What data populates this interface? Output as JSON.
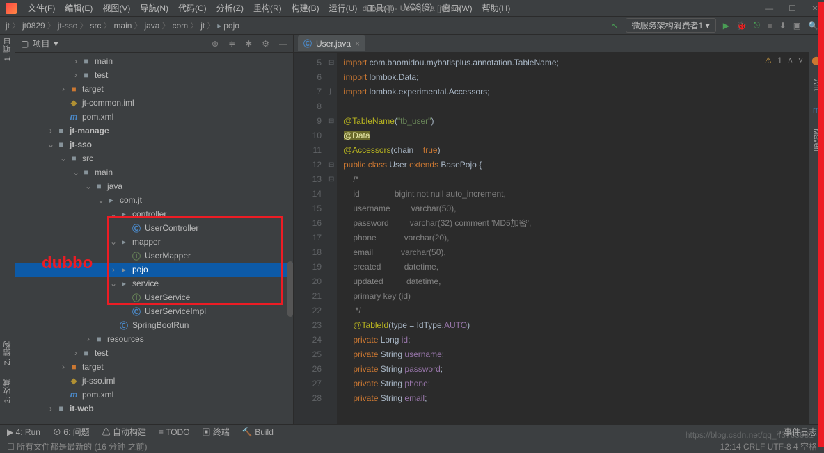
{
  "menubar": {
    "items": [
      "文件(F)",
      "编辑(E)",
      "视图(V)",
      "导航(N)",
      "代码(C)",
      "分析(Z)",
      "重构(R)",
      "构建(B)",
      "运行(U)",
      "工具(T)",
      "VCS(S)",
      "窗口(W)",
      "帮助(H)"
    ],
    "title": "dubbo-jt - User.java [jt-sso]"
  },
  "breadcrumbs": [
    "jt",
    "jt0829",
    "jt-sso",
    "src",
    "main",
    "java",
    "com",
    "jt",
    "pojo"
  ],
  "run_config": "微服务架构消费者1",
  "project_panel": {
    "title": "项目"
  },
  "left_tabs": [
    "1: 项目"
  ],
  "left_tabs_bottom": [
    "Z: 结构",
    "2: 收藏"
  ],
  "right_tabs": [
    "Ant",
    "Maven"
  ],
  "tree": [
    {
      "depth": 4,
      "arrow": ">",
      "icon": "folder",
      "label": "main"
    },
    {
      "depth": 4,
      "arrow": ">",
      "icon": "folder",
      "label": "test"
    },
    {
      "depth": 3,
      "arrow": ">",
      "icon": "folder-orange",
      "label": "target"
    },
    {
      "depth": 3,
      "arrow": "",
      "icon": "iml",
      "label": "jt-common.iml"
    },
    {
      "depth": 3,
      "arrow": "",
      "icon": "mvn",
      "label": "pom.xml"
    },
    {
      "depth": 2,
      "arrow": ">",
      "icon": "folder",
      "label": "jt-manage",
      "bold": true
    },
    {
      "depth": 2,
      "arrow": "v",
      "icon": "folder",
      "label": "jt-sso",
      "bold": true
    },
    {
      "depth": 3,
      "arrow": "v",
      "icon": "folder",
      "label": "src"
    },
    {
      "depth": 4,
      "arrow": "v",
      "icon": "folder",
      "label": "main"
    },
    {
      "depth": 5,
      "arrow": "v",
      "icon": "folder",
      "label": "java"
    },
    {
      "depth": 6,
      "arrow": "v",
      "icon": "pkg",
      "label": "com.jt"
    },
    {
      "depth": 7,
      "arrow": "v",
      "icon": "pkg",
      "label": "controller"
    },
    {
      "depth": 8,
      "arrow": "",
      "icon": "class",
      "label": "UserController"
    },
    {
      "depth": 7,
      "arrow": "v",
      "icon": "pkg",
      "label": "mapper"
    },
    {
      "depth": 8,
      "arrow": "",
      "icon": "iface",
      "label": "UserMapper"
    },
    {
      "depth": 7,
      "arrow": ">",
      "icon": "pkg",
      "label": "pojo",
      "selected": true
    },
    {
      "depth": 7,
      "arrow": "v",
      "icon": "pkg",
      "label": "service"
    },
    {
      "depth": 8,
      "arrow": "",
      "icon": "iface",
      "label": "UserService"
    },
    {
      "depth": 8,
      "arrow": "",
      "icon": "class",
      "label": "UserServiceImpl"
    },
    {
      "depth": 7,
      "arrow": "",
      "icon": "class",
      "label": "SpringBootRun"
    },
    {
      "depth": 5,
      "arrow": ">",
      "icon": "folder",
      "label": "resources"
    },
    {
      "depth": 4,
      "arrow": ">",
      "icon": "folder",
      "label": "test"
    },
    {
      "depth": 3,
      "arrow": ">",
      "icon": "folder-orange",
      "label": "target"
    },
    {
      "depth": 3,
      "arrow": "",
      "icon": "iml",
      "label": "jt-sso.iml"
    },
    {
      "depth": 3,
      "arrow": "",
      "icon": "mvn",
      "label": "pom.xml"
    },
    {
      "depth": 2,
      "arrow": ">",
      "icon": "folder",
      "label": "it-web",
      "bold": true
    }
  ],
  "annotation": "dubbo",
  "editor_tab": "User.java",
  "warnings": "1",
  "code": {
    "start": 5,
    "lines": [
      {
        "n": 5,
        "html": "<span class='kw'>import</span> com.baomidou.mybatisplus.annotation.<span class='cls'>TableName</span>;"
      },
      {
        "n": 6,
        "html": "<span class='kw'>import</span> lombok.<span class='cls'>Data</span>;"
      },
      {
        "n": 7,
        "html": "<span class='kw'>import</span> lombok.experimental.<span class='cls'>Accessors</span>;"
      },
      {
        "n": 8,
        "html": ""
      },
      {
        "n": 9,
        "html": "<span class='ann'>@TableName</span>(<span class='str'>\"tb_user\"</span>)"
      },
      {
        "n": 10,
        "html": "<span class='ann-data'>@Data</span>"
      },
      {
        "n": 11,
        "html": "<span class='ann'>@Accessors</span>(chain = <span class='kw'>true</span>)"
      },
      {
        "n": 12,
        "html": "<span class='kw'>public class</span> <span class='cls'>User</span> <span class='kw'>extends</span> BasePojo {"
      },
      {
        "n": 13,
        "html": "    <span class='comment'>/*</span>"
      },
      {
        "n": 14,
        "html": "    <span class='comment'>id               bigint not null auto_increment,</span>"
      },
      {
        "n": 15,
        "html": "    <span class='comment'>username         varchar(50),</span>"
      },
      {
        "n": 16,
        "html": "    <span class='comment'>password         varchar(32) comment 'MD5加密',</span>"
      },
      {
        "n": 17,
        "html": "    <span class='comment'>phone            varchar(20),</span>"
      },
      {
        "n": 18,
        "html": "    <span class='comment'>email            varchar(50),</span>"
      },
      {
        "n": 19,
        "html": "    <span class='comment'>created          datetime,</span>"
      },
      {
        "n": 20,
        "html": "    <span class='comment'>updated          datetime,</span>"
      },
      {
        "n": 21,
        "html": "    <span class='comment'>primary key (id)</span>"
      },
      {
        "n": 22,
        "html": "    <span class='comment'> */</span>"
      },
      {
        "n": 23,
        "html": "    <span class='ann'>@TableId</span>(type = IdType.<span class='fld'>AUTO</span>)"
      },
      {
        "n": 24,
        "html": "    <span class='kw'>private</span> Long <span class='fld'>id</span>;"
      },
      {
        "n": 25,
        "html": "    <span class='kw'>private</span> String <span class='fld'>username</span>;"
      },
      {
        "n": 26,
        "html": "    <span class='kw'>private</span> String <span class='fld'>password</span>;"
      },
      {
        "n": 27,
        "html": "    <span class='kw'>private</span> String <span class='fld'>phone</span>;"
      },
      {
        "n": 28,
        "html": "    <span class='kw'>private</span> String <span class='fld'>email</span>;"
      }
    ]
  },
  "bottom_tabs": [
    "4: Run",
    "6: 问题",
    "自动构建",
    "TODO",
    "终端",
    "Build"
  ],
  "bottom_right": "事件日志",
  "status_left": "所有文件都是最新的 (16 分钟 之前)",
  "status_right": "12:14   CRLF   UTF-8   4 空格",
  "watermark": "https://blog.csdn.net/qq_43765981"
}
